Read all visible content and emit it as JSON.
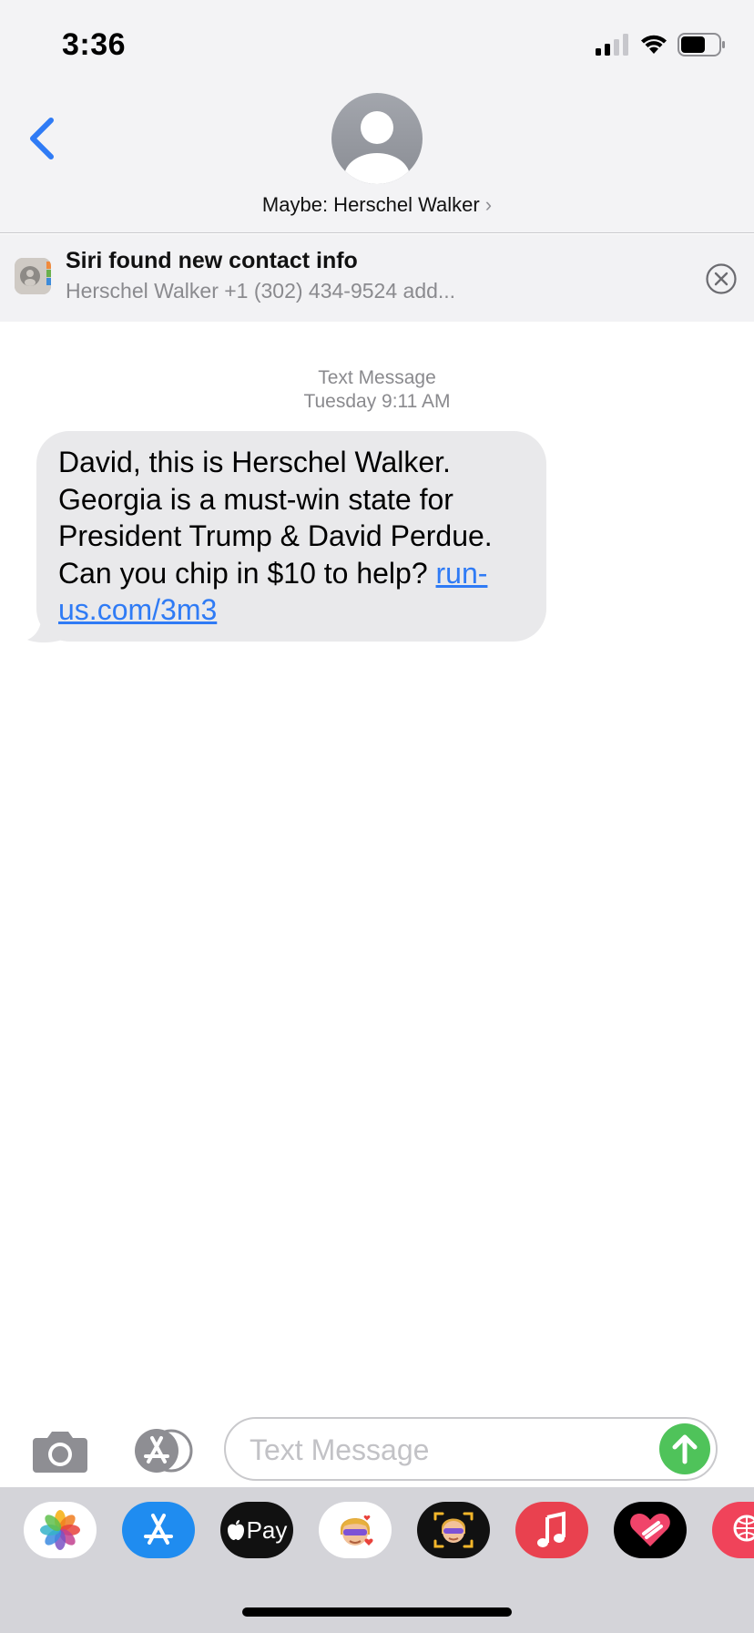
{
  "status_bar": {
    "time": "3:36"
  },
  "header": {
    "contact_label": "Maybe: Herschel Walker"
  },
  "siri_banner": {
    "title": "Siri found new contact info",
    "subtitle": "Herschel Walker +1 (302) 434-9524  add..."
  },
  "conversation": {
    "service": "Text Message",
    "timestamp_day": "Tuesday",
    "timestamp_time": "9:11 AM",
    "message_text": "David, this is Herschel Walker. Georgia is a must-win state for President Trump & David Perdue. Can you chip in $10 to help? ",
    "message_link": "run-us.com/3m3"
  },
  "input_bar": {
    "placeholder": "Text Message"
  },
  "app_drawer": {
    "apps": [
      {
        "name": "photos-app",
        "icon": "photos-icon",
        "label": ""
      },
      {
        "name": "app-store-app",
        "icon": "app-store-icon",
        "label": ""
      },
      {
        "name": "apple-pay-app",
        "icon": "apple-pay-icon",
        "label": "Pay"
      },
      {
        "name": "memoji-stickers-app",
        "icon": "memoji-icon",
        "label": ""
      },
      {
        "name": "animoji-app",
        "icon": "animoji-icon",
        "label": ""
      },
      {
        "name": "music-app",
        "icon": "music-icon",
        "label": ""
      },
      {
        "name": "digital-touch-app",
        "icon": "digital-touch-icon",
        "label": ""
      },
      {
        "name": "images-app",
        "icon": "globe-search-icon",
        "label": ""
      }
    ]
  },
  "colors": {
    "accent_blue": "#2f7bf5",
    "send_green": "#4fc35a",
    "bubble_gray": "#e9e9eb",
    "header_bg": "#f3f3f5"
  }
}
